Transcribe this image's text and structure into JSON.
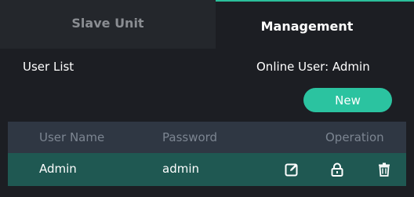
{
  "tabs": {
    "slave_unit": "Slave Unit",
    "management": "Management"
  },
  "header": {
    "user_list": "User List",
    "online_user": "Online User: Admin",
    "new_button": "New"
  },
  "table": {
    "columns": {
      "user_name": "User Name",
      "password": "Password",
      "operation": "Operation"
    },
    "rows": [
      {
        "user_name": "Admin",
        "password": "admin",
        "operations": [
          "edit-icon",
          "lock-icon",
          "trash-icon"
        ]
      }
    ]
  },
  "colors": {
    "accent": "#2bc3a0",
    "row_highlight": "#1f5852",
    "table_header": "#2f3743",
    "background": "#1c1e23"
  }
}
